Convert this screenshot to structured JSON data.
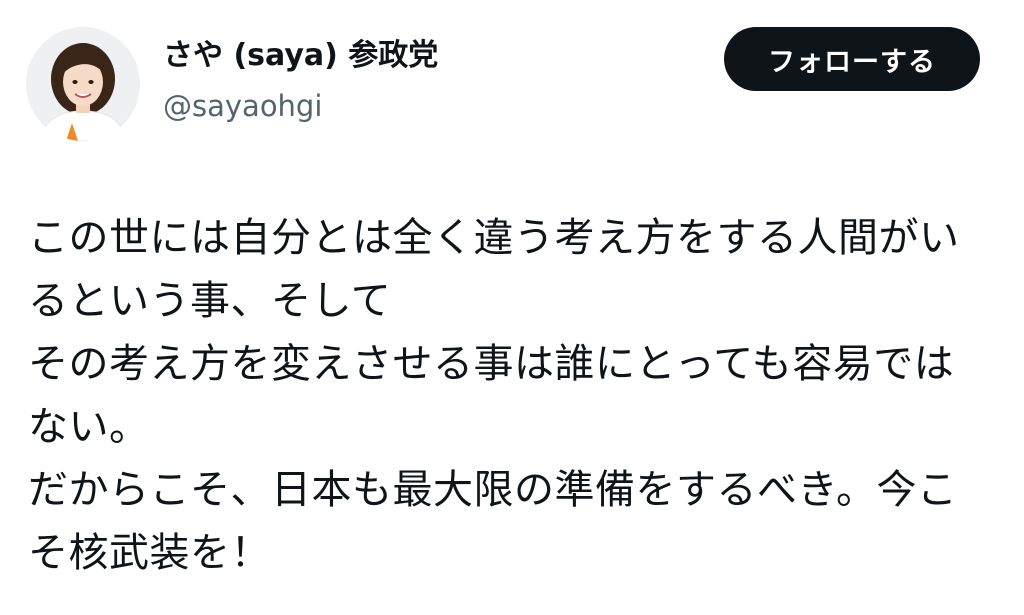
{
  "author": {
    "display_name": "さや (saya) 参政党",
    "handle": "@sayaohgi",
    "avatar_icon": "profile-photo"
  },
  "follow_button": {
    "label": "フォローする"
  },
  "post": {
    "lines": [
      "この世には自分とは全く違う考え方をする人間がい",
      "るという事、そして",
      "その考え方を変えさせる事は誰にとっても容易では",
      "ない。",
      "だからこそ、日本も最大限の準備をするべき。今こ",
      "そ核武装を！"
    ]
  },
  "colors": {
    "text": "#0f1419",
    "secondary_text": "#536471",
    "button_bg": "#0f1419",
    "button_text": "#ffffff"
  }
}
